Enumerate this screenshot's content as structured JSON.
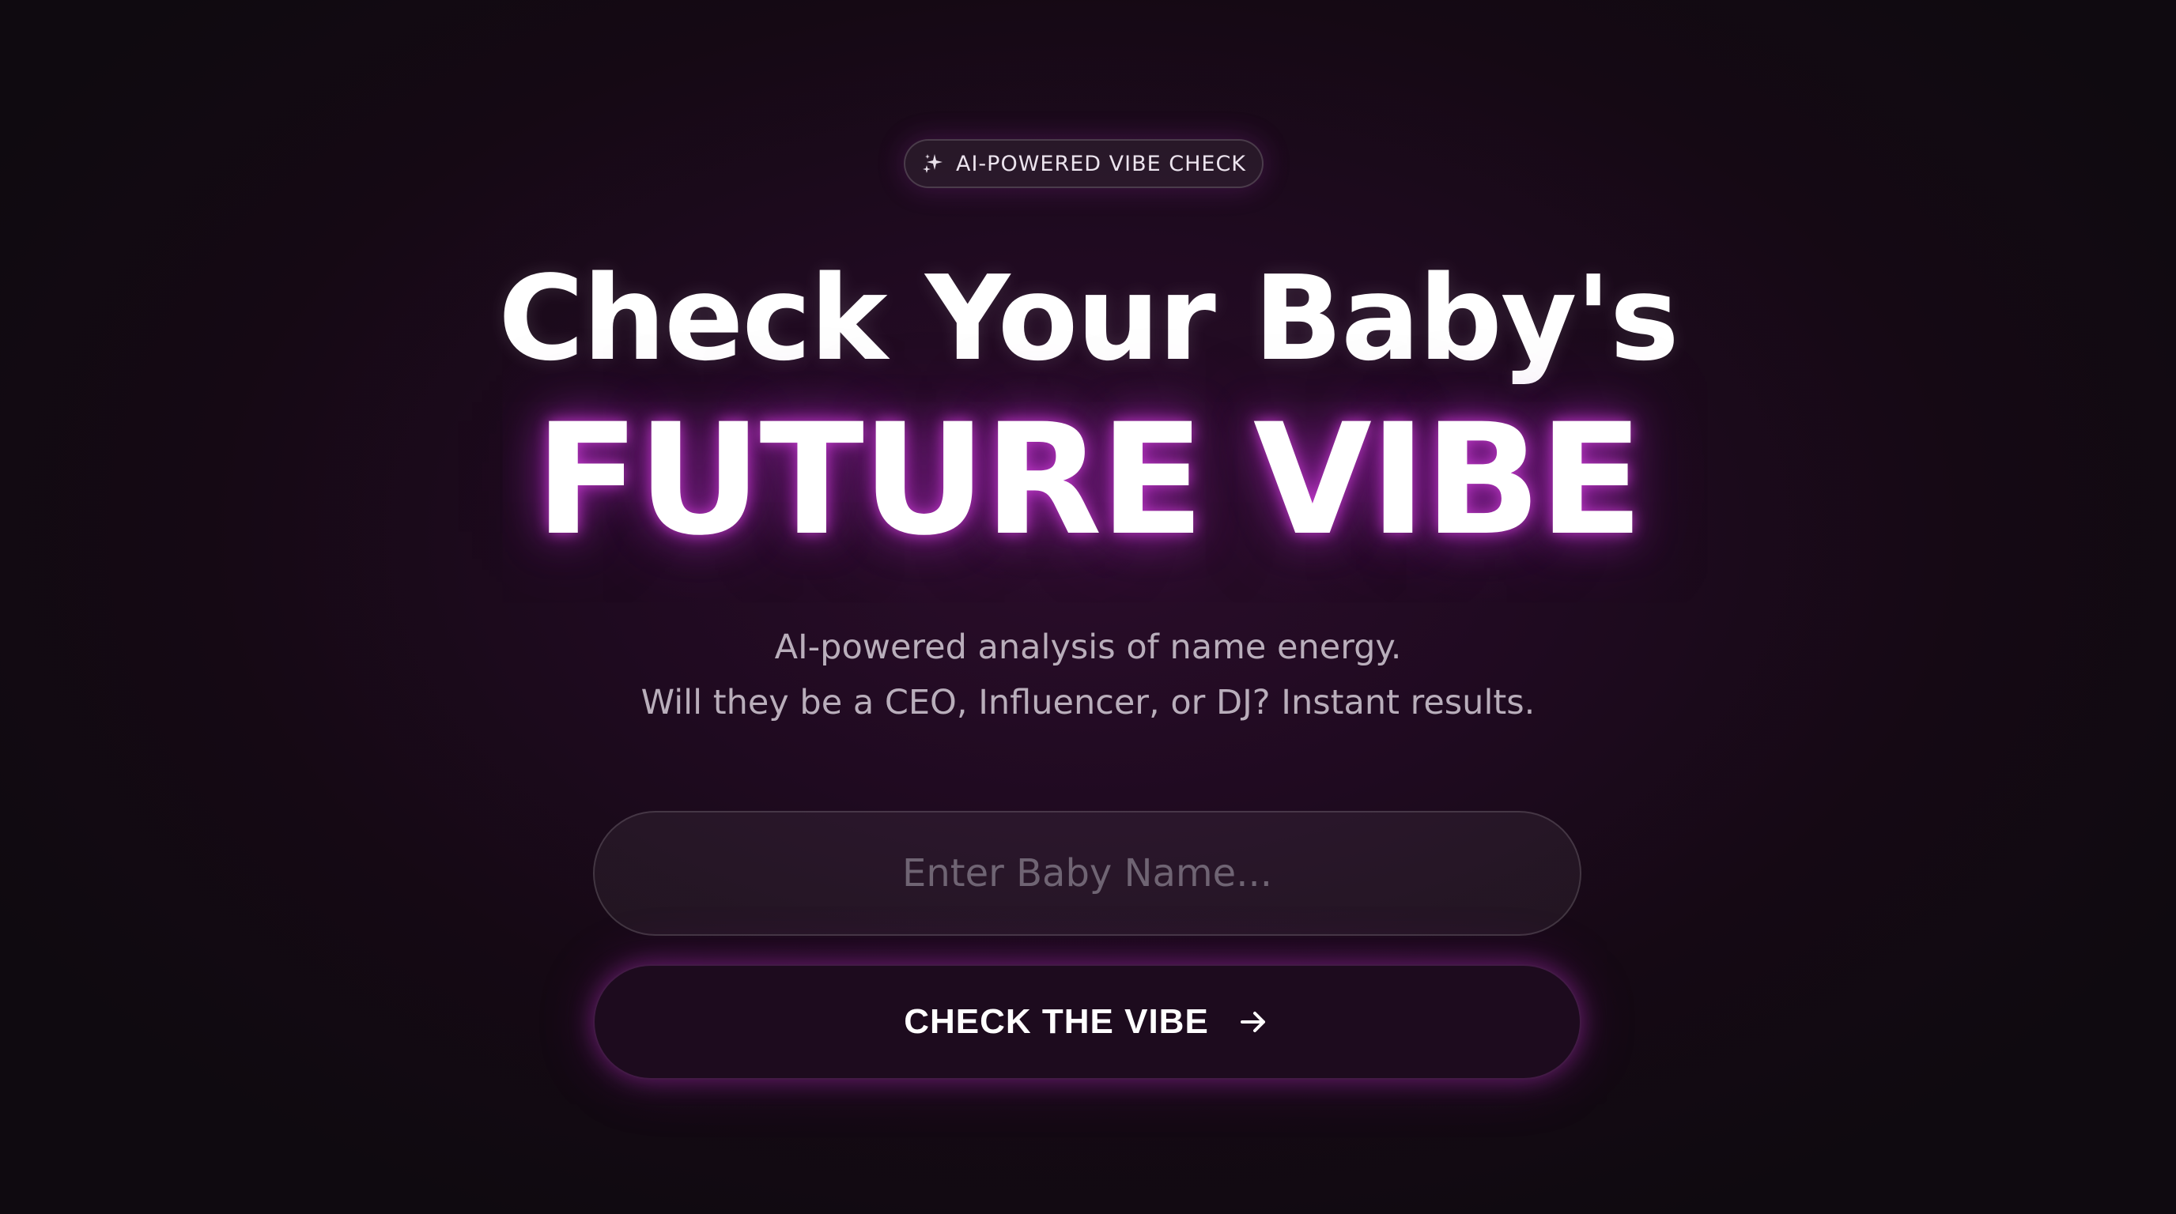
{
  "badge": {
    "icon": "sparkles-icon",
    "label": "AI-POWERED VIBE CHECK"
  },
  "hero": {
    "headline_line1": "Check Your Baby's",
    "headline_line2": "FUTURE VIBE"
  },
  "subtitle": {
    "line1": "AI-powered analysis of name energy.",
    "line2": "Will they be a CEO, Influencer, or DJ? Instant results."
  },
  "form": {
    "name_value": "",
    "name_placeholder": "Enter Baby Name...",
    "submit_label": "CHECK THE VIBE",
    "submit_icon": "arrow-right-icon"
  },
  "colors": {
    "background": "#150914",
    "glow_accent": "#b030c0",
    "text_primary": "#ffffff",
    "text_muted": "#b9aebb",
    "placeholder": "#6f6473"
  }
}
